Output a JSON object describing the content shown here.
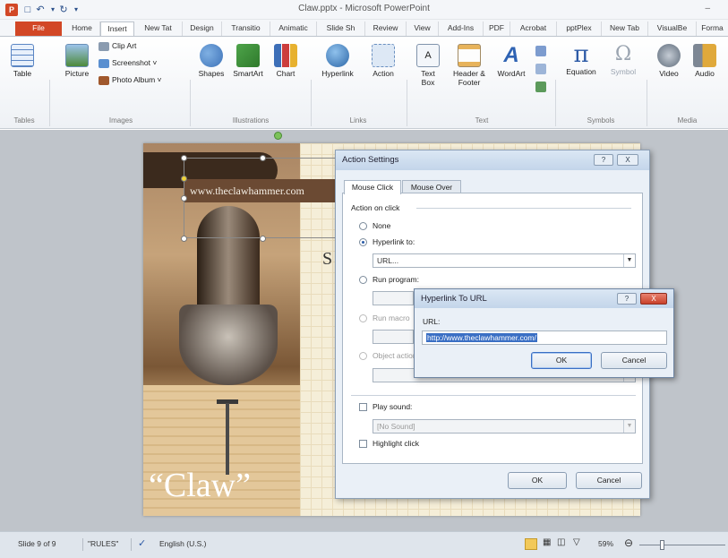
{
  "titlebar": {
    "title": "Claw.pptx - Microsoft PowerPoint",
    "app_icon": "P",
    "minimize": "–"
  },
  "tabs": [
    "File",
    "Home",
    "Insert",
    "New Tat",
    "Design",
    "Transitio",
    "Animatic",
    "Slide Sh",
    "Review",
    "View",
    "Add-Ins",
    "PDF",
    "Acrobat",
    "pptPlex",
    "New Tab",
    "VisualBe",
    "Forma"
  ],
  "ribbon": {
    "table": "Table",
    "picture": "Picture",
    "clip_art": "Clip Art",
    "screenshot": "Screenshot ˅",
    "photo_album": "Photo Album ˅",
    "shapes": "Shapes",
    "smartart": "SmartArt",
    "chart": "Chart",
    "hyperlink": "Hyperlink",
    "action": "Action",
    "textbox": "Text Box",
    "header_footer": "Header & Footer",
    "wordart": "WordArt",
    "equation": "Equation",
    "symbol": "Symbol",
    "video": "Video",
    "audio": "Audio",
    "groups": {
      "tables": "Tables",
      "images": "Images",
      "illustrations": "Illustrations",
      "links": "Links",
      "text": "Text",
      "symbols": "Symbols",
      "media": "Media"
    }
  },
  "slide": {
    "url_text": "www.theclawhammer.com",
    "title_text": "“Claw”",
    "fragment": "S"
  },
  "action_dialog": {
    "title": "Action Settings",
    "help": "?",
    "close": "X",
    "tabs": [
      "Mouse Click",
      "Mouse Over"
    ],
    "section": "Action on click",
    "none": "None",
    "hyperlink_to": "Hyperlink to:",
    "hyperlink_value": "URL...",
    "run_program": "Run program:",
    "run_macro": "Run macro:",
    "object_action": "Object action:",
    "play_sound": "Play sound:",
    "sound_value": "[No Sound]",
    "highlight_click": "Highlight click",
    "ok": "OK",
    "cancel": "Cancel"
  },
  "hyperlink_dialog": {
    "title": "Hyperlink To URL",
    "help": "?",
    "close": "X",
    "url_label": "URL:",
    "url_value": "http://www.theclawhammer.com/",
    "ok": "OK",
    "cancel": "Cancel"
  },
  "statusbar": {
    "slide_info": "Slide 9 of 9",
    "theme": "\"RULES\"",
    "language": "English (U.S.)",
    "zoom": "59%"
  }
}
